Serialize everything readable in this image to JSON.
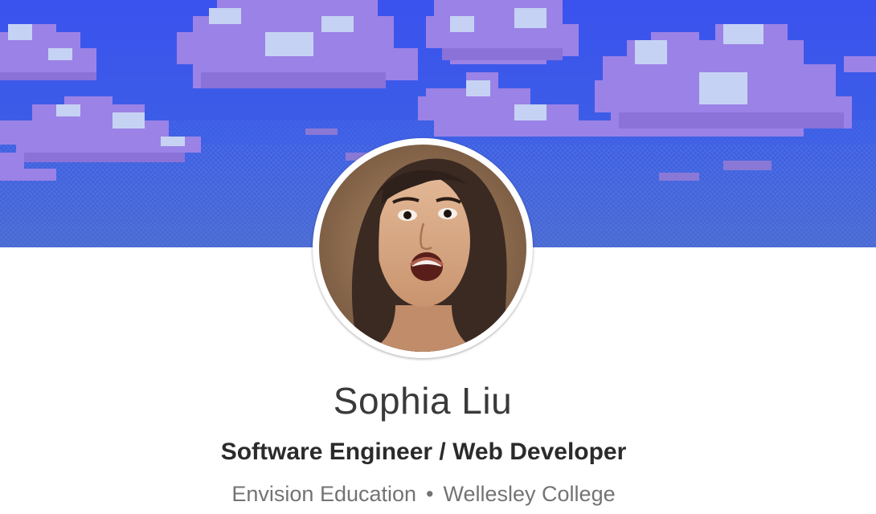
{
  "profile": {
    "name": "Sophia Liu",
    "headline": "Software Engineer / Web Developer",
    "company": "Envision Education",
    "separator": "•",
    "school": "Wellesley College"
  },
  "banner": {
    "sky_top": "#3a5bf0",
    "sky_bottom": "#4a6ad8",
    "cloud_color": "#9b82e6",
    "cloud_highlight": "#c6d2f3",
    "cloud_shadow": "#8a78d6"
  },
  "colors": {
    "name_text": "#3a3a3a",
    "headline_text": "#2b2b2b",
    "meta_text": "#737373"
  },
  "icons": {
    "cover": "pixel-clouds-cover-image",
    "photo": "profile-photo"
  }
}
